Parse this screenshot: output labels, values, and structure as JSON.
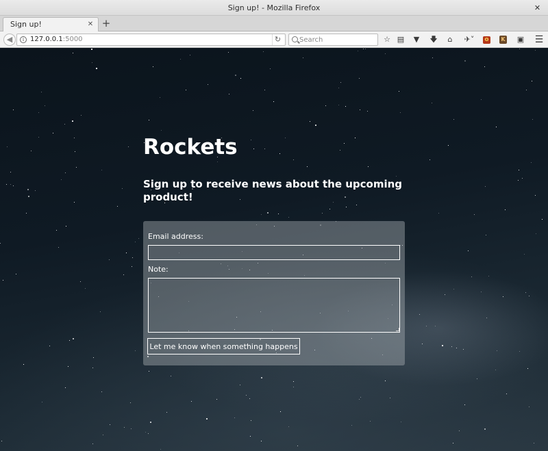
{
  "window": {
    "title": "Sign up! - Mozilla Firefox",
    "close_glyph": "✕"
  },
  "tabs": [
    {
      "label": "Sign up!",
      "close_glyph": "✕"
    }
  ],
  "new_tab_glyph": "+",
  "navbar": {
    "url_host": "127.0.0.1",
    "url_port": ":5000",
    "search_placeholder": "Search",
    "icons": [
      "back-arrow-icon",
      "info-icon",
      "reload-icon",
      "search-icon",
      "bookmark-star-icon",
      "reading-list-icon",
      "pocket-icon",
      "download-icon",
      "home-icon",
      "extension-dropdown-icon",
      "extension-red-icon",
      "extension-brown-icon",
      "extension-dark-icon",
      "menu-hamburger-icon"
    ]
  },
  "page": {
    "heading": "Rockets",
    "subheading": "Sign up to receive news about the upcoming product!",
    "form": {
      "email_label": "Email address:",
      "email_value": "",
      "note_label": "Note:",
      "note_value": "",
      "submit_label": "Let me know when something happens"
    }
  },
  "colors": {
    "page_background": "#0f1a24",
    "text": "#ffffff",
    "form_panel": "rgba(165,170,175,0.45)"
  }
}
